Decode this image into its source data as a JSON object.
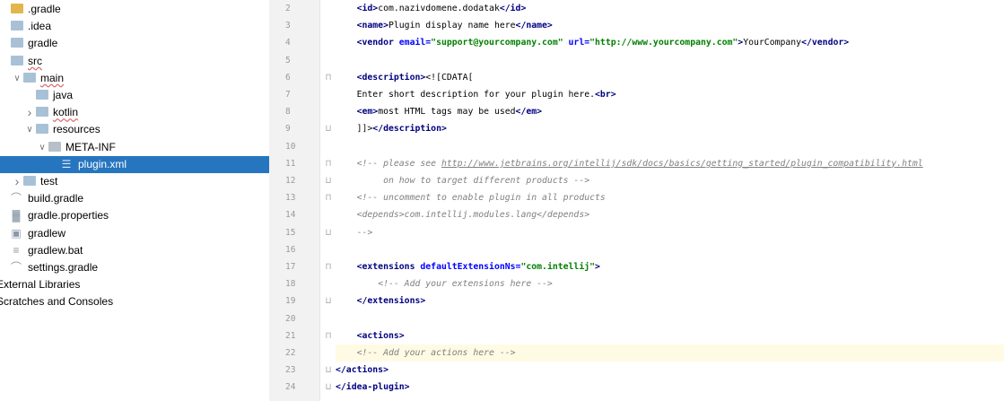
{
  "project_tree": [
    {
      "label": ".gradle",
      "icon": "folder-icon-yellow",
      "indent": 0,
      "expander": "",
      "selected": false
    },
    {
      "label": ".idea",
      "icon": "folder-icon",
      "indent": 0,
      "expander": "",
      "selected": false
    },
    {
      "label": "gradle",
      "icon": "folder-icon",
      "indent": 0,
      "expander": "",
      "selected": false
    },
    {
      "label": "src",
      "icon": "folder-icon",
      "indent": 0,
      "expander": "",
      "selected": false
    },
    {
      "label": "main",
      "icon": "folder-icon",
      "indent": 1,
      "expander": "chevron-down",
      "selected": false
    },
    {
      "label": "java",
      "icon": "folder-icon",
      "indent": 2,
      "expander": "",
      "selected": false
    },
    {
      "label": "kotlin",
      "icon": "folder-icon",
      "indent": 2,
      "expander": "chevron-right",
      "selected": false
    },
    {
      "label": "resources",
      "icon": "resources-folder-icon",
      "indent": 2,
      "expander": "chevron-down",
      "selected": false
    },
    {
      "label": "META-INF",
      "icon": "folder-icon-gray",
      "indent": 3,
      "expander": "chevron-down",
      "selected": false
    },
    {
      "label": "plugin.xml",
      "icon": "xml-file-icon",
      "indent": 4,
      "expander": "",
      "selected": true
    },
    {
      "label": "test",
      "icon": "folder-icon",
      "indent": 1,
      "expander": "chevron-right",
      "selected": false
    },
    {
      "label": "build.gradle",
      "icon": "gradle-file-icon",
      "indent": 0,
      "expander": "",
      "selected": false
    },
    {
      "label": "gradle.properties",
      "icon": "properties-file-icon",
      "indent": 0,
      "expander": "",
      "selected": false
    },
    {
      "label": "gradlew",
      "icon": "script-file-icon",
      "indent": 0,
      "expander": "",
      "selected": false
    },
    {
      "label": "gradlew.bat",
      "icon": "text-file-icon",
      "indent": 0,
      "expander": "",
      "selected": false
    },
    {
      "label": "settings.gradle",
      "icon": "gradle-file-icon",
      "indent": 0,
      "expander": "",
      "selected": false
    },
    {
      "label": "External Libraries",
      "icon": "",
      "indent": -1,
      "expander": "",
      "selected": false
    },
    {
      "label": "Scratches and Consoles",
      "icon": "",
      "indent": -1,
      "expander": "",
      "selected": false
    }
  ],
  "editor": {
    "current_line": 22,
    "lines": [
      {
        "n": "2",
        "fold": "",
        "segs": [
          [
            "    ",
            ""
          ],
          [
            "<id>",
            "tag"
          ],
          [
            "com.nazivdomene.dodatak",
            "txt"
          ],
          [
            "</id>",
            "tag"
          ]
        ]
      },
      {
        "n": "3",
        "fold": "",
        "segs": [
          [
            "    ",
            ""
          ],
          [
            "<name>",
            "tag"
          ],
          [
            "Plugin display name here",
            "txt"
          ],
          [
            "</name>",
            "tag"
          ]
        ]
      },
      {
        "n": "4",
        "fold": "",
        "segs": [
          [
            "    ",
            ""
          ],
          [
            "<vendor ",
            "tag"
          ],
          [
            "email=",
            "attr"
          ],
          [
            "\"support@yourcompany.com\"",
            "str"
          ],
          [
            " url=",
            "attr"
          ],
          [
            "\"http://www.yourcompany.com\"",
            "str"
          ],
          [
            ">",
            "tag"
          ],
          [
            "YourCompany",
            "txt"
          ],
          [
            "</vendor>",
            "tag"
          ]
        ]
      },
      {
        "n": "5",
        "fold": "",
        "segs": []
      },
      {
        "n": "6",
        "fold": "open",
        "segs": [
          [
            "    ",
            ""
          ],
          [
            "<description>",
            "tag"
          ],
          [
            "<![CDATA[",
            "txt"
          ]
        ]
      },
      {
        "n": "7",
        "fold": "",
        "segs": [
          [
            "    ",
            ""
          ],
          [
            "Enter short description for your plugin here.",
            "txt"
          ],
          [
            "<br>",
            "tag"
          ]
        ]
      },
      {
        "n": "8",
        "fold": "",
        "segs": [
          [
            "    ",
            ""
          ],
          [
            "<em>",
            "tag"
          ],
          [
            "most HTML tags may be used",
            "txt"
          ],
          [
            "</em>",
            "tag"
          ]
        ]
      },
      {
        "n": "9",
        "fold": "close",
        "segs": [
          [
            "    ",
            ""
          ],
          [
            "]]>",
            "txt"
          ],
          [
            "</description>",
            "tag"
          ]
        ]
      },
      {
        "n": "10",
        "fold": "",
        "segs": []
      },
      {
        "n": "11",
        "fold": "open",
        "segs": [
          [
            "    ",
            ""
          ],
          [
            "<!-- please see ",
            "cmt"
          ],
          [
            "http://www.jetbrains.org/intellij/sdk/docs/basics/getting_started/plugin_compatibility.html",
            "cmt-link"
          ]
        ]
      },
      {
        "n": "12",
        "fold": "close",
        "segs": [
          [
            "         on how to target different products -->",
            "cmt"
          ]
        ]
      },
      {
        "n": "13",
        "fold": "open",
        "segs": [
          [
            "    ",
            ""
          ],
          [
            "<!-- uncomment to enable plugin in all products",
            "cmt"
          ]
        ]
      },
      {
        "n": "14",
        "fold": "",
        "segs": [
          [
            "    ",
            ""
          ],
          [
            "<depends>com.intellij.modules.lang</depends>",
            "cmt"
          ]
        ]
      },
      {
        "n": "15",
        "fold": "close",
        "segs": [
          [
            "    ",
            ""
          ],
          [
            "-->",
            "cmt"
          ]
        ]
      },
      {
        "n": "16",
        "fold": "",
        "segs": []
      },
      {
        "n": "17",
        "fold": "open",
        "segs": [
          [
            "    ",
            ""
          ],
          [
            "<extensions ",
            "tag"
          ],
          [
            "defaultExtensionNs=",
            "attr"
          ],
          [
            "\"com.intellij\"",
            "str"
          ],
          [
            ">",
            "tag"
          ]
        ]
      },
      {
        "n": "18",
        "fold": "",
        "segs": [
          [
            "        ",
            ""
          ],
          [
            "<!-- Add your extensions here -->",
            "cmt"
          ]
        ]
      },
      {
        "n": "19",
        "fold": "close",
        "segs": [
          [
            "    ",
            ""
          ],
          [
            "</extensions>",
            "tag"
          ]
        ]
      },
      {
        "n": "20",
        "fold": "",
        "segs": []
      },
      {
        "n": "21",
        "fold": "open",
        "segs": [
          [
            "    ",
            ""
          ],
          [
            "<actions>",
            "tag"
          ]
        ]
      },
      {
        "n": "22",
        "fold": "",
        "segs": [
          [
            "    ",
            ""
          ],
          [
            "<!-- Add your actions here -->",
            "cmt"
          ]
        ]
      },
      {
        "n": "23",
        "fold": "close",
        "segs": [
          [
            "</actions>",
            "tag"
          ]
        ]
      },
      {
        "n": "24",
        "fold": "close",
        "segs": [
          [
            "</idea-plugin>",
            "tag"
          ]
        ]
      }
    ]
  },
  "colors": {
    "selection": "#2675bf",
    "current_line": "#fffae3",
    "tag": "#000080",
    "string": "#008000",
    "comment": "#808080"
  }
}
